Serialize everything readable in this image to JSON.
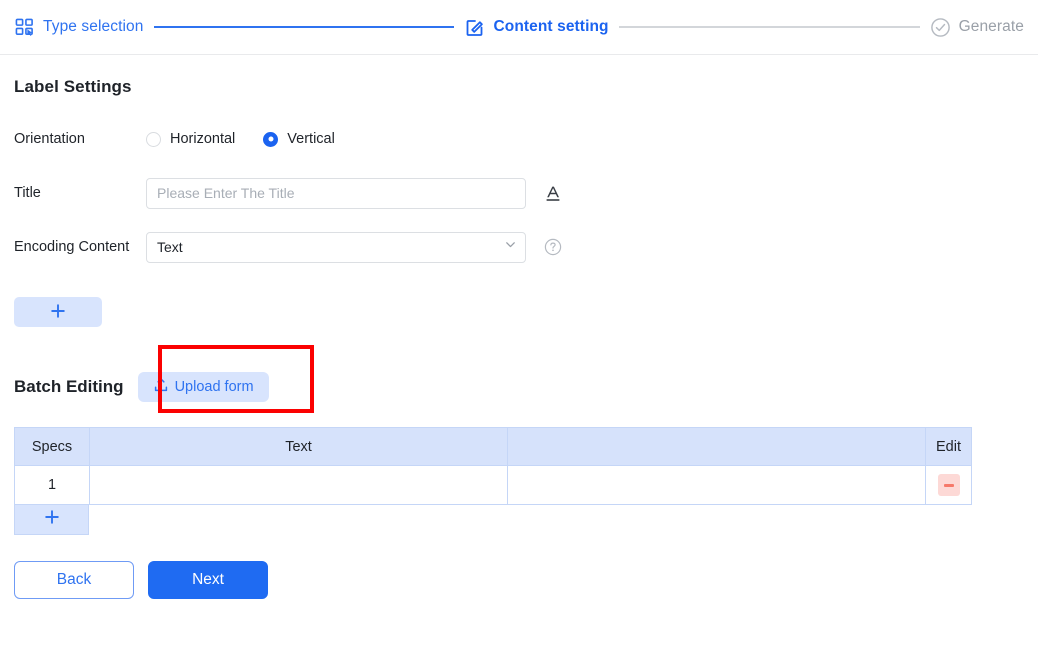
{
  "stepper": {
    "steps": [
      {
        "label": "Type selection",
        "icon": "grid-select-icon",
        "state": "done"
      },
      {
        "label": "Content setting",
        "icon": "edit-square-icon",
        "state": "current"
      },
      {
        "label": "Generate",
        "icon": "check-circle-icon",
        "state": "todo"
      }
    ],
    "connector_done_color": "#2f73f0",
    "connector_todo_color": "#d3d6da"
  },
  "section": {
    "title": "Label Settings"
  },
  "orientation": {
    "label": "Orientation",
    "options": [
      {
        "label": "Horizontal",
        "selected": false
      },
      {
        "label": "Vertical",
        "selected": true
      }
    ]
  },
  "title_field": {
    "label": "Title",
    "value": "",
    "placeholder": "Please Enter The Title",
    "icon": "font-style-icon"
  },
  "encoding": {
    "label": "Encoding Content",
    "value": "Text",
    "options": [
      "Text"
    ],
    "chevron_icon": "chevron-down-icon",
    "help_icon": "help-circle-icon"
  },
  "add_field": {
    "icon": "plus-icon",
    "label": "+"
  },
  "batch": {
    "title": "Batch Editing",
    "upload_label": "Upload form",
    "upload_icon": "upload-icon",
    "annotation_color": "#fb0101"
  },
  "table": {
    "headers": [
      "Specs",
      "Text",
      "",
      "Edit"
    ],
    "rows": [
      {
        "specs": "1",
        "text": "",
        "extra": "",
        "delete_icon": "minus-icon"
      }
    ],
    "add_row_label": "+",
    "header_bg": "#d6e2fb",
    "border_color": "#c5d6f7"
  },
  "footer": {
    "back_label": "Back",
    "next_label": "Next",
    "primary_color": "#1f6bf2"
  }
}
